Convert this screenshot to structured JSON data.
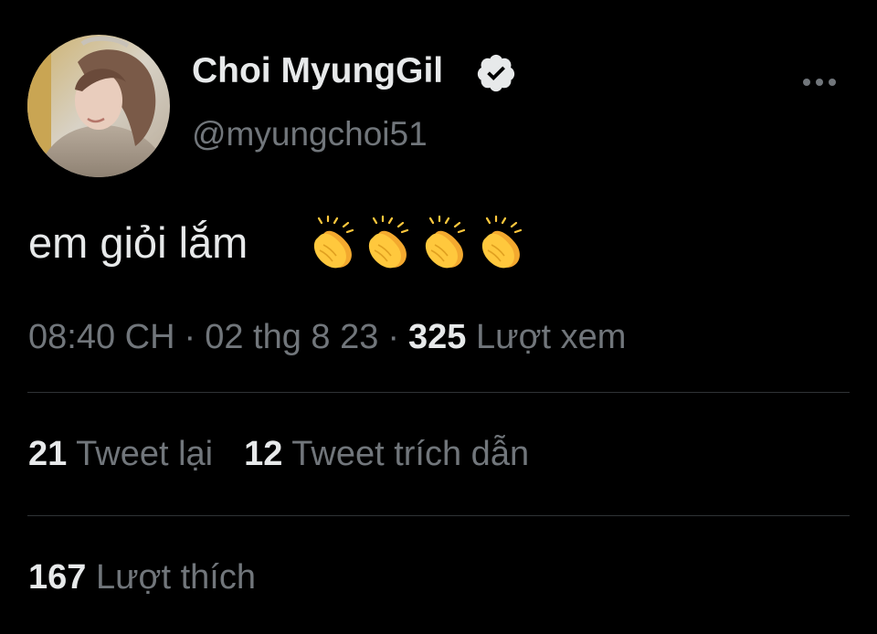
{
  "author": {
    "display_name": "Choi MyungGil",
    "handle": "@myungchoi51",
    "verified": true,
    "avatar_icon": "profile-photo"
  },
  "tweet": {
    "text": "em giỏi lắm",
    "emoji": [
      "clapping-hands",
      "clapping-hands",
      "clapping-hands",
      "clapping-hands"
    ]
  },
  "meta": {
    "time": "08:40 CH",
    "separator": "·",
    "date": "02 thg 8 23",
    "views_count": "325",
    "views_label": "Lượt xem"
  },
  "stats": {
    "retweets_count": "21",
    "retweets_label": "Tweet lại",
    "quotes_count": "12",
    "quotes_label": "Tweet trích dẫn",
    "likes_count": "167",
    "likes_label": "Lượt thích"
  },
  "colors": {
    "background": "#000000",
    "primary_text": "#e7e9ea",
    "secondary_text": "#71767b",
    "divider": "#2f3336",
    "emoji_yellow": "#ffc83d"
  }
}
